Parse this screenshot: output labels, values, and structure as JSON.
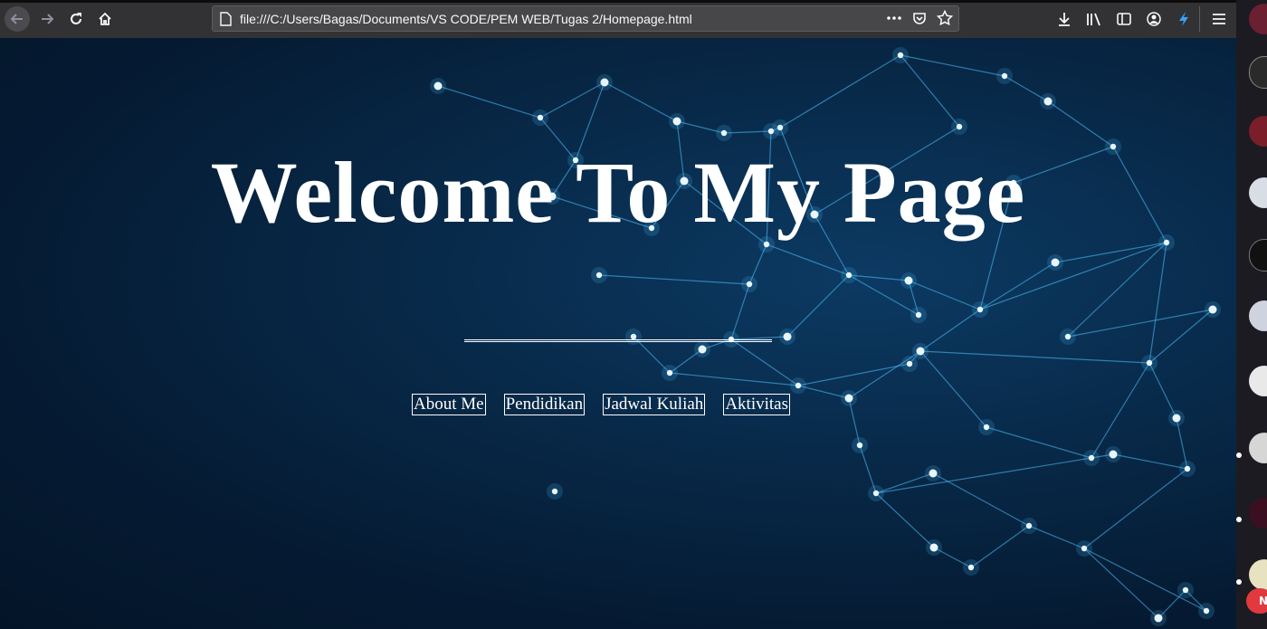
{
  "browser": {
    "url": "file:///C:/Users/Bagas/Documents/VS CODE/PEM WEB/Tugas 2/Homepage.html",
    "url_actions": [
      "more-icon",
      "pocket-icon",
      "bookmark-star-icon"
    ],
    "toolbar_icons": [
      "download-icon",
      "library-icon",
      "sidebar-icon",
      "account-icon",
      "extension-icon"
    ]
  },
  "page": {
    "title": "Welcome To My Page",
    "nav": [
      {
        "label": "About Me"
      },
      {
        "label": "Pendidikan"
      },
      {
        "label": "Jadwal Kuliah"
      },
      {
        "label": "Aktivitas"
      }
    ]
  },
  "sidebar": {
    "badge": "N"
  },
  "colors": {
    "toolbar": "#323234",
    "page_bg": "#051b33",
    "network": "#4fc3ff",
    "text": "#ffffff",
    "badge": "#e0393e"
  }
}
